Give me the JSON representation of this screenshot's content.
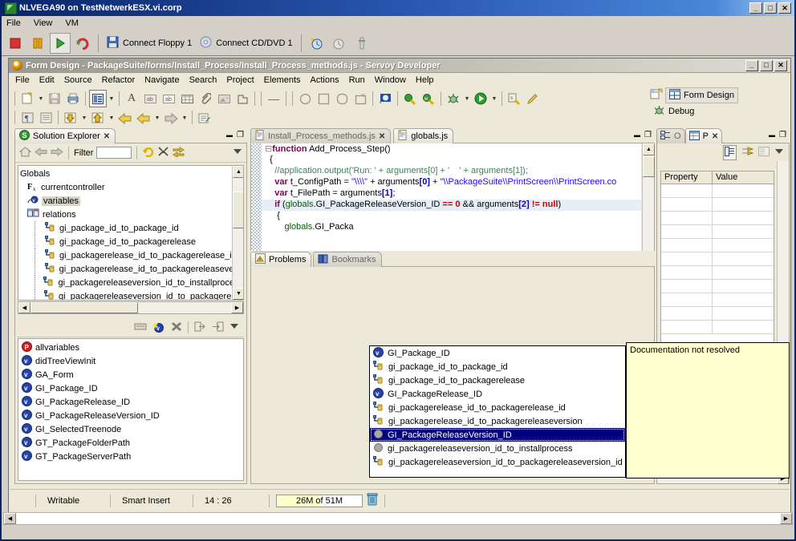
{
  "vm": {
    "title": "NLVEGA90 on TestNetwerkESX.vi.corp",
    "title_icon": "vm-console-icon",
    "menus": [
      "File",
      "View",
      "VM"
    ],
    "buttons": {
      "stop": "stop-icon",
      "pause": "pause-icon",
      "play": "play-icon",
      "reset": "reset-icon",
      "floppy_label": "Connect Floppy 1",
      "floppy_icon": "floppy-icon",
      "cd_label": "Connect CD/DVD 1",
      "cd_icon": "cd-dvd-icon",
      "snapshot": "snapshot-icon",
      "revert": "revert-snapshot-icon",
      "manager": "snapshot-manager-icon"
    },
    "sys": {
      "minimize": "_",
      "maximize": "□",
      "close": "✕"
    }
  },
  "ide": {
    "title": "Form Design - PackageSuite/forms/Install_Process/Install_Process_methods.js - Servoy Developer",
    "title_icon": "servoy-icon",
    "menus": [
      "File",
      "Edit",
      "Source",
      "Refactor",
      "Navigate",
      "Search",
      "Project",
      "Elements",
      "Actions",
      "Run",
      "Window",
      "Help"
    ],
    "sys": {
      "minimize": "_",
      "maximize": "□",
      "close": "✕"
    },
    "toolbar_row1": [
      "new-wizard-icon",
      "dropdown-arrow",
      "save-icon",
      "print-icon",
      "open-type-icon",
      "dropdown-arrow",
      "text-style-icon",
      "label-ab-icon",
      "field-ab-icon",
      "table-icon",
      "paperclip-icon",
      "image-icon",
      "tab-panel-icon",
      "divider",
      "minus-icon"
    ],
    "toolbar_row2": [
      "paragraph-icon",
      "list-icon",
      "align-down-icon",
      "dropdown-arrow",
      "align-up-icon",
      "dropdown-arrow",
      "back-yellow-icon",
      "forward-yellow-icon",
      "dropdown-arrow",
      "next-grey-icon",
      "dropdown-arrow",
      "new-method-icon"
    ],
    "toolbar_shapes": [
      "circle-icon",
      "square-icon",
      "rounded-rect-icon",
      "text-frame-icon"
    ],
    "toolbar_right": [
      "flag-icon",
      "search-key-icon",
      "search-w-icon",
      "debug-bug-icon",
      "dropdown-arrow",
      "run-green-icon",
      "dropdown-arrow",
      "servoy-key-icon",
      "pen-icon"
    ],
    "perspectives": [
      {
        "label": "Form Design",
        "icon": "form-design-icon",
        "active": true
      },
      {
        "label": "Debug",
        "icon": "debug-icon",
        "active": false
      }
    ],
    "perspective_open_icon": "open-perspective-icon"
  },
  "solution_explorer": {
    "tab": {
      "label": "Solution Explorer",
      "icon": "solution-explorer-icon",
      "close": "✕"
    },
    "view_buttons": {
      "minimize": "▬",
      "maximize": "❐"
    },
    "toolbar": {
      "home_icon": "home-icon",
      "back_icon": "back-arrow-icon",
      "forward_icon": "forward-arrow-icon",
      "filter_label": "Filter",
      "filter_value": "",
      "filter_placeholder": "",
      "refresh_icon": "refresh-icon",
      "collapse_icon": "collapse-all-icon",
      "link_icon": "link-with-editor-icon",
      "menu_icon": "view-menu-icon"
    },
    "tree": [
      {
        "label": "Globals",
        "icon": "none",
        "indent": 0,
        "selected": false
      },
      {
        "label": "currentcontroller",
        "icon": "fx-icon",
        "indent": 1,
        "selected": false
      },
      {
        "label": "variables",
        "icon": "variables-icon",
        "indent": 1,
        "selected": true
      },
      {
        "label": "relations",
        "icon": "relations-icon",
        "indent": 1,
        "selected": false
      },
      {
        "label": "gi_package_id_to_package_id",
        "icon": "relation-icon",
        "indent": 2,
        "selected": false
      },
      {
        "label": "gi_package_id_to_packagerelease",
        "icon": "relation-icon",
        "indent": 2,
        "selected": false
      },
      {
        "label": "gi_packagerelease_id_to_packagerelease_id",
        "icon": "relation-icon",
        "indent": 2,
        "selected": false
      },
      {
        "label": "gi_packagerelease_id_to_packagereleaseversi",
        "icon": "relation-icon",
        "indent": 2,
        "selected": false
      },
      {
        "label": "gi_packagereleaseversion_id_to_installprocess",
        "icon": "relation-icon",
        "indent": 2,
        "selected": false
      },
      {
        "label": "gi_packagereleaseversion_id_to_packagerelea",
        "icon": "relation-icon",
        "indent": 2,
        "selected": false
      }
    ],
    "detail_toolbar": {
      "rename_icon": "rename-icon",
      "new_variable_icon": "new-variable-icon",
      "delete_icon": "delete-x-icon",
      "move_icon": "move-out-icon",
      "move_in_icon": "move-in-icon",
      "menu_icon": "view-menu-icon"
    },
    "detail_list": [
      {
        "label": "allvariables",
        "icon": "p-red-icon"
      },
      {
        "label": "didTreeViewInit",
        "icon": "variable-blue-icon"
      },
      {
        "label": "GA_Form",
        "icon": "variable-blue-icon"
      },
      {
        "label": "GI_Package_ID",
        "icon": "variable-blue-icon"
      },
      {
        "label": "GI_PackageRelease_ID",
        "icon": "variable-blue-icon"
      },
      {
        "label": "GI_PackageReleaseVersion_ID",
        "icon": "variable-blue-icon"
      },
      {
        "label": "GI_SelectedTreenode",
        "icon": "variable-blue-icon"
      },
      {
        "label": "GT_PackageFolderPath",
        "icon": "variable-blue-icon"
      },
      {
        "label": "GT_PackageServerPath",
        "icon": "variable-blue-icon"
      }
    ]
  },
  "editor": {
    "tabs": [
      {
        "label": "Install_Process_methods.js",
        "icon": "js-file-icon",
        "active": true,
        "close": "✕"
      },
      {
        "label": "globals.js",
        "icon": "js-file-icon",
        "active": false,
        "close": ""
      }
    ],
    "view_buttons": {
      "minimize": "▬",
      "maximize": "❐"
    },
    "code_lines": [
      "function Add_Process_Step()",
      "{",
      "  //application.output('Run: ' + arguments[0] + '    ' + arguments[1]);",
      "  var t_ConfigPath = \"\\\\\\\\\" + arguments[0] + \"\\\\PackageSuite\\\\PrintScreen\\\\PrintScreen.co",
      "  var t_FilePath = arguments[1];",
      "  if (globals.GI_PackageReleaseVersion_ID == 0 && arguments[2] != null)",
      "  {",
      "      globals.GI_Packa"
    ]
  },
  "content_assist": {
    "items": [
      {
        "label": "GI_Package_ID",
        "icon": "variable-blue-icon",
        "selected": false
      },
      {
        "label": "gi_package_id_to_package_id",
        "icon": "relation-icon",
        "selected": false
      },
      {
        "label": "gi_package_id_to_packagerelease",
        "icon": "relation-icon",
        "selected": false
      },
      {
        "label": "GI_PackageRelease_ID",
        "icon": "variable-blue-icon",
        "selected": false
      },
      {
        "label": "gi_packagerelease_id_to_packagerelease_id",
        "icon": "relation-icon",
        "selected": false
      },
      {
        "label": "gi_packagerelease_id_to_packagereleaseversion",
        "icon": "relation-icon",
        "selected": false
      },
      {
        "label": "GI_PackageReleaseVersion_ID",
        "icon": "variable-grey-icon",
        "selected": true
      },
      {
        "label": "gi_packagereleaseversion_id_to_installprocess",
        "icon": "variable-grey-icon",
        "selected": false
      },
      {
        "label": "gi_packagereleaseversion_id_to_packagereleaseversion_id",
        "icon": "relation-icon",
        "selected": false
      }
    ],
    "doc_text": "Documentation not resolved"
  },
  "bottom_view": {
    "tabs": [
      {
        "label": "Problems",
        "icon": "problems-icon",
        "active": true
      },
      {
        "label": "Bookmarks",
        "icon": "bookmarks-icon",
        "active": false
      }
    ]
  },
  "properties_view": {
    "tabs": [
      {
        "label": "O",
        "icon": "outline-icon",
        "active": false
      },
      {
        "label": "P",
        "icon": "properties-icon",
        "active": true,
        "close": "✕"
      }
    ],
    "view_buttons": {
      "minimize": "▬",
      "maximize": "❐"
    },
    "toolbar": {
      "categories_icon": "show-categories-icon",
      "advanced_icon": "show-advanced-icon",
      "restore_icon": "restore-defaults-icon",
      "menu_icon": "view-menu-icon"
    },
    "columns": [
      "Property",
      "Value"
    ],
    "row_count": 11
  },
  "status_bar": {
    "new_item_icon": "new-element-icon",
    "writable": "Writable",
    "insert_mode": "Smart Insert",
    "position": "14 : 26",
    "heap": "26M of 51M",
    "heap_percent": 51,
    "trash_icon": "trash-icon"
  },
  "colors": {
    "vm_title_start": "#0a246a",
    "ide_chrome": "#ece9d8",
    "selection_blue": "#000080",
    "doc_yellow": "#ffffd0",
    "keyword": "#7f0055",
    "comment": "#3f7f5f",
    "string": "#2a00ff"
  }
}
